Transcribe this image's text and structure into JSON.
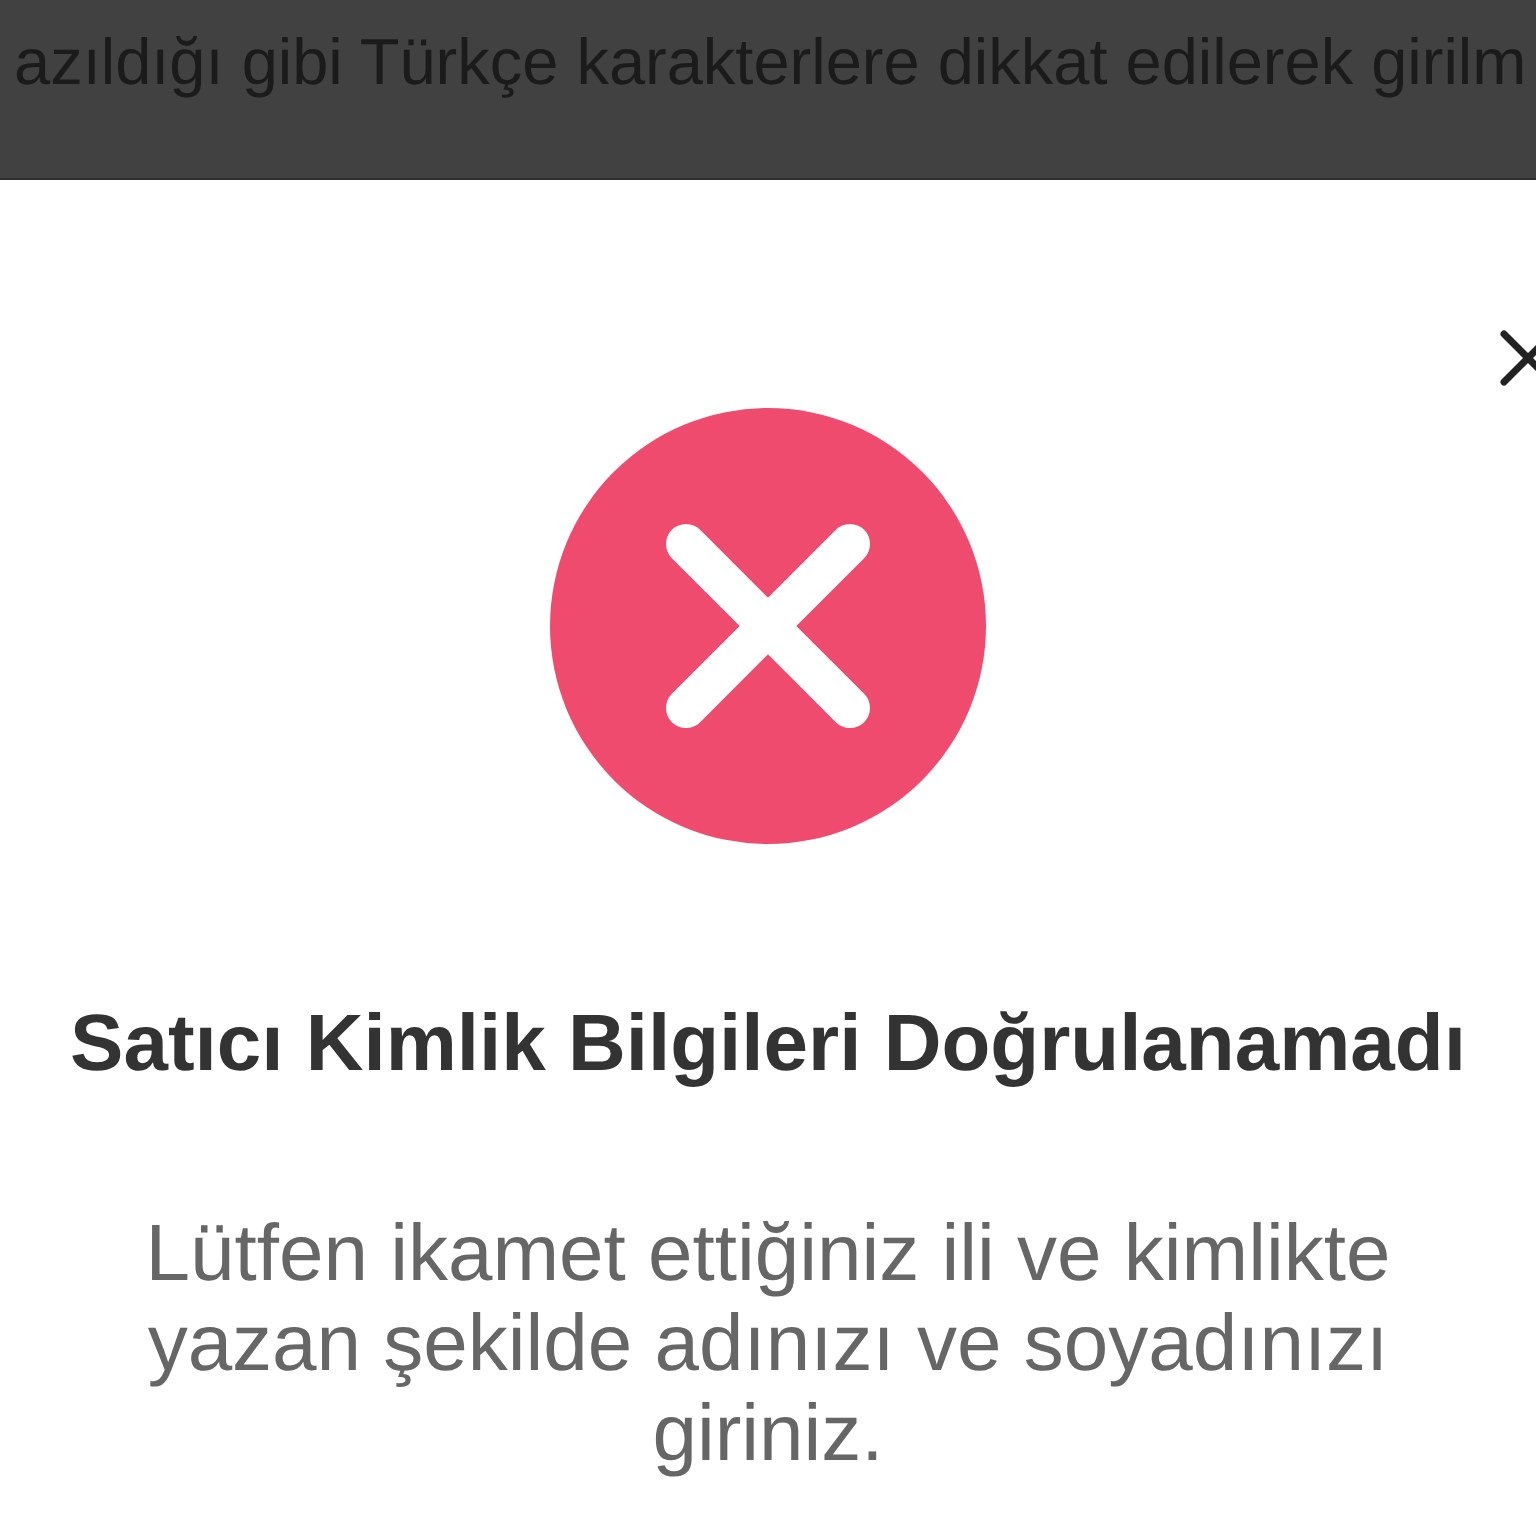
{
  "top_banner": {
    "text": "azıldığı gibi Türkçe karakterlere dikkat edilerek girilm"
  },
  "dialog": {
    "title": "Satıcı Kimlik Bilgileri Doğrulanamadı",
    "message": "Lütfen ikamet ettiğiniz ili ve kimlikte yazan şekilde adınızı ve soyadınızı giriniz."
  }
}
